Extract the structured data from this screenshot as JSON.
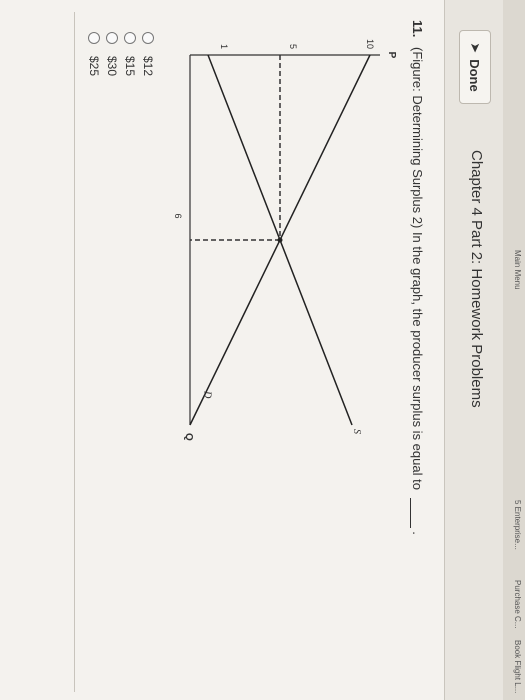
{
  "topnav": {
    "items": [
      "Main Menu",
      "5 Enterprise...",
      "Purchase C...",
      "Book Flight L..."
    ]
  },
  "header": {
    "done_label": "Done",
    "done_icon": "arrow-icon",
    "title": "Chapter 4 Part 2: Homework Problems"
  },
  "question": {
    "number": "11.",
    "text": "(Figure: Determining Surplus 2) In the graph, the producer surplus is equal to",
    "end_punct": "."
  },
  "graph": {
    "y_label": "P",
    "x_label": "Q",
    "supply_label": "S",
    "demand_label": "D",
    "y_ticks": [
      "10",
      "5",
      "1"
    ],
    "x_ticks": [
      "6"
    ]
  },
  "chart_data": {
    "type": "line",
    "xlabel": "Q",
    "ylabel": "P",
    "xlim": [
      0,
      12
    ],
    "ylim": [
      0,
      10
    ],
    "series": [
      {
        "name": "S",
        "x": [
          0,
          12
        ],
        "y": [
          1,
          9
        ]
      },
      {
        "name": "D",
        "x": [
          0,
          12
        ],
        "y": [
          10,
          0
        ]
      }
    ],
    "equilibrium": {
      "x": 6,
      "y": 5
    }
  },
  "choices": [
    "$12",
    "$15",
    "$30",
    "$25"
  ]
}
